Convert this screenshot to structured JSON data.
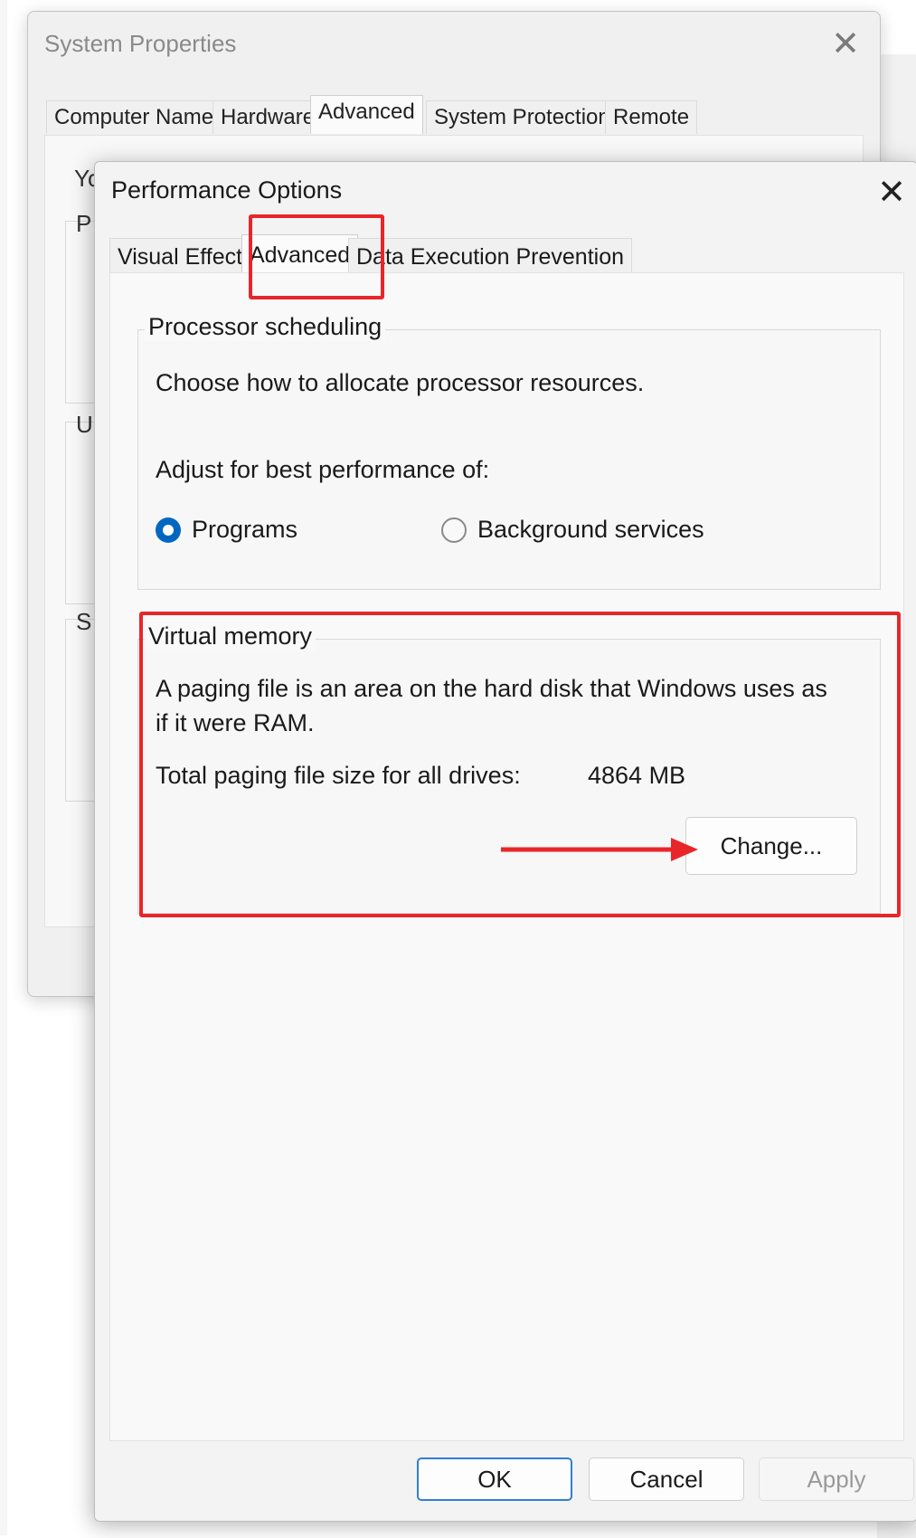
{
  "system_properties": {
    "title": "System Properties",
    "close_glyph": "✕",
    "tabs": [
      {
        "label": "Computer Name"
      },
      {
        "label": "Hardware"
      },
      {
        "label": "Advanced",
        "active": true
      },
      {
        "label": "System Protection"
      },
      {
        "label": "Remote"
      }
    ],
    "partial_text": {
      "line1": "Yo",
      "perf_initial": "P",
      "user_initial": "U",
      "startup_initial": "S"
    }
  },
  "performance_options": {
    "title": "Performance Options",
    "close_glyph": "✕",
    "tabs": [
      {
        "label": "Visual Effects"
      },
      {
        "label": "Advanced",
        "active": true
      },
      {
        "label": "Data Execution Prevention"
      }
    ],
    "processor_scheduling": {
      "group_label": "Processor scheduling",
      "description": "Choose how to allocate processor resources.",
      "adjust_label": "Adjust for best performance of:",
      "options": [
        {
          "label": "Programs",
          "selected": true
        },
        {
          "label": "Background services",
          "selected": false
        }
      ]
    },
    "virtual_memory": {
      "group_label": "Virtual memory",
      "description_line1": "A paging file is an area on the hard disk that Windows uses as",
      "description_line2": "if it were RAM.",
      "total_label": "Total paging file size for all drives:",
      "total_value": "4864 MB",
      "change_button": "Change..."
    },
    "buttons": {
      "ok": "OK",
      "cancel": "Cancel",
      "apply": "Apply"
    }
  },
  "annotations": {
    "highlight_color": "#e8262a",
    "arrow_color": "#e8262a"
  },
  "colors": {
    "accent": "#0067c0"
  }
}
